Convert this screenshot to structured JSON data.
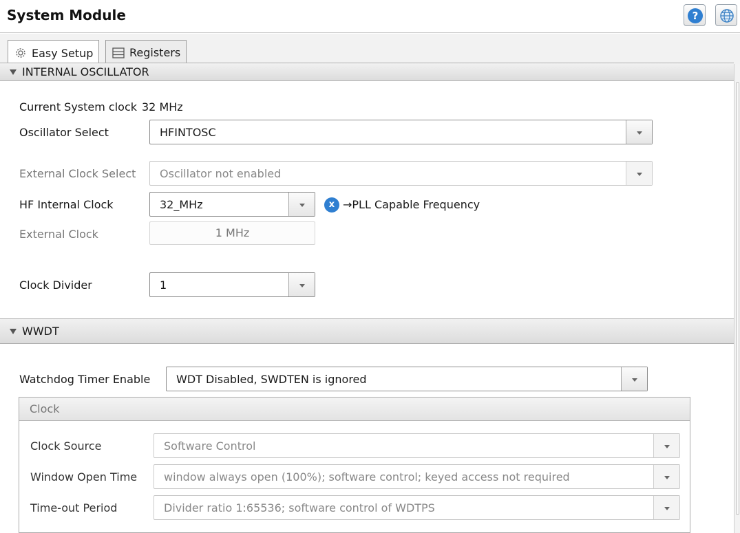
{
  "window": {
    "title": "System Module"
  },
  "header_buttons": {
    "help_icon": "question-mark",
    "help_glyph": "?",
    "web_icon": "globe"
  },
  "tabs": [
    {
      "label": "Easy Setup",
      "icon": "gear",
      "active": true
    },
    {
      "label": "Registers",
      "icon": "list",
      "active": false
    }
  ],
  "internal_oscillator": {
    "section_title": "INTERNAL OSCILLATOR",
    "current_clock_label": "Current System clock",
    "current_clock_value": "32 MHz",
    "oscillator_select": {
      "label": "Oscillator Select",
      "value": "HFINTOSC"
    },
    "external_clock_select": {
      "label": "External Clock Select",
      "value": "Oscillator not enabled",
      "disabled": true
    },
    "hf_internal_clock": {
      "label": "HF Internal Clock",
      "value": "32_MHz",
      "badge_glyph": "x",
      "note": "→PLL Capable Frequency"
    },
    "external_clock": {
      "label": "External Clock",
      "value": "1 MHz",
      "disabled": true
    },
    "clock_divider": {
      "label": "Clock Divider",
      "value": "1"
    }
  },
  "wwdt": {
    "section_title": "WWDT",
    "watchdog_enable": {
      "label": "Watchdog Timer Enable",
      "value": "WDT Disabled, SWDTEN is ignored"
    },
    "clock_panel": {
      "title": "Clock",
      "clock_source": {
        "label": "Clock Source",
        "value": "Software Control",
        "disabled": true
      },
      "window_open_time": {
        "label": "Window Open Time",
        "value": "window always open (100%); software control; keyed access not required",
        "disabled": true
      },
      "timeout_period": {
        "label": "Time-out Period",
        "value": "Divider ratio 1:65536; software control of WDTPS",
        "disabled": true
      }
    }
  },
  "colors": {
    "accent": "#2f7fd1",
    "header_gradient_top": "#f1f1f1",
    "header_gradient_bottom": "#dcdcdc"
  }
}
